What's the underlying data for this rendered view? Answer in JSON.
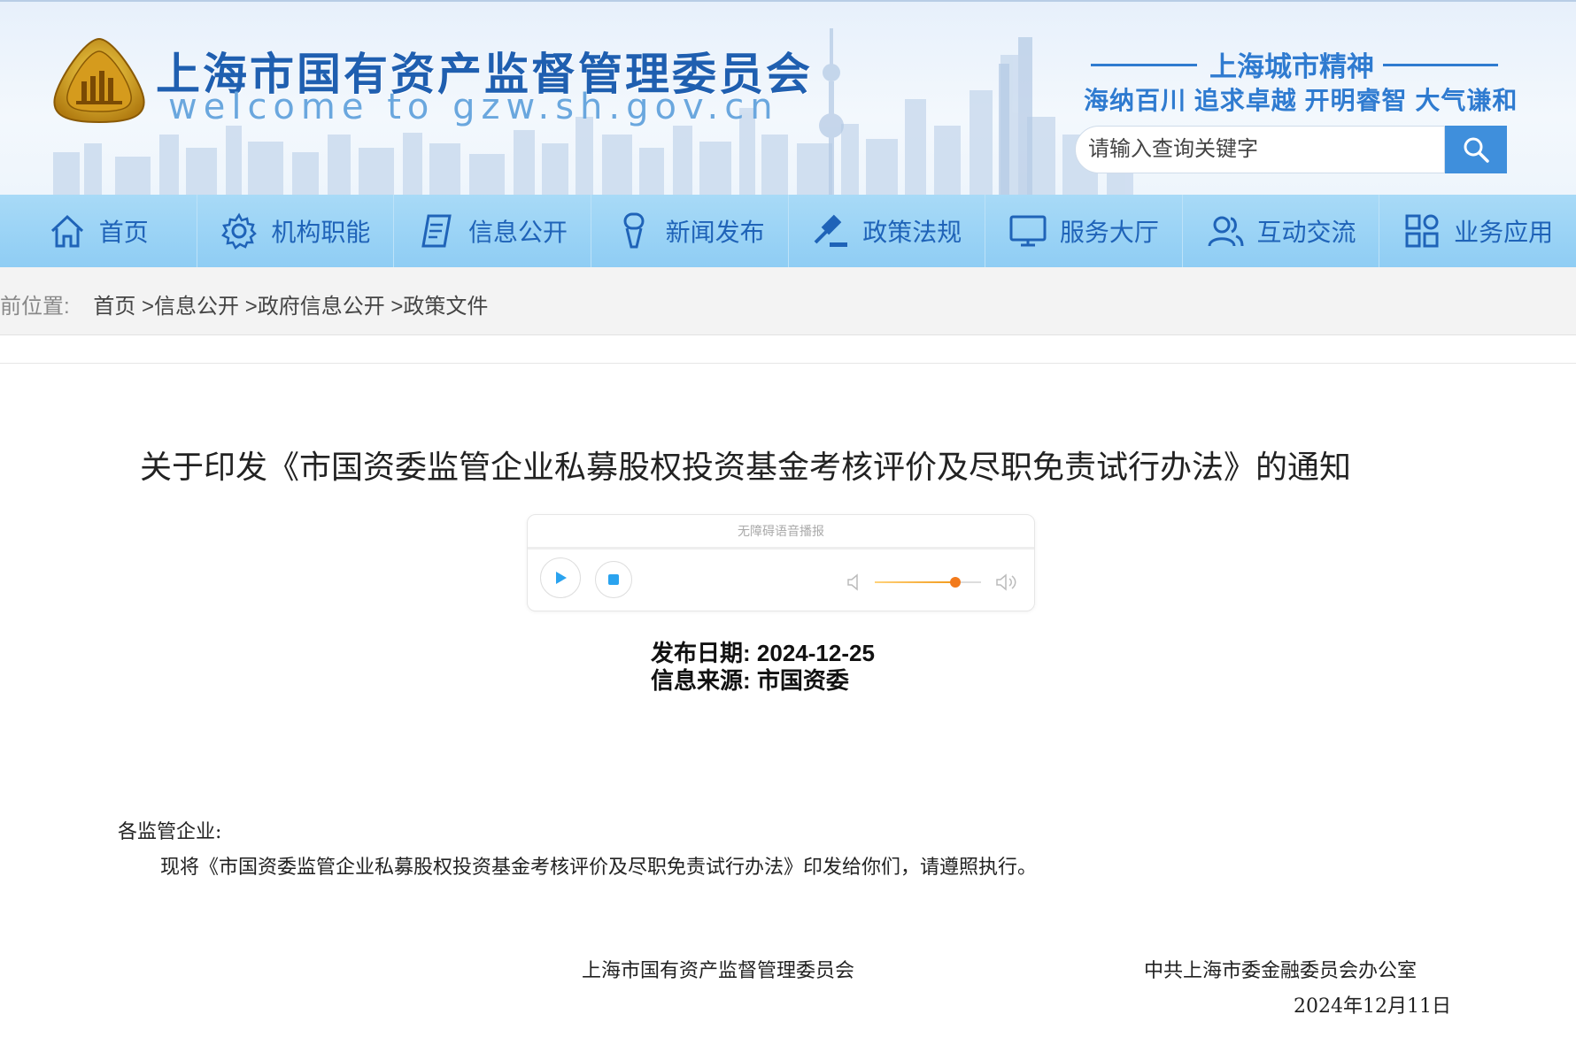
{
  "header": {
    "site_title": "上海市国有资产监督管理委员会",
    "site_subtitle": "welcome to gzw.sh.gov.cn",
    "spirit_title": "上海城市精神",
    "spirit_text": "海纳百川 追求卓越 开明睿智 大气谦和",
    "search_placeholder": "请输入查询关键字"
  },
  "nav": [
    {
      "label": "首页",
      "icon": "home-icon"
    },
    {
      "label": "机构职能",
      "icon": "gear-icon"
    },
    {
      "label": "信息公开",
      "icon": "document-icon"
    },
    {
      "label": "新闻发布",
      "icon": "microphone-icon"
    },
    {
      "label": "政策法规",
      "icon": "gavel-icon"
    },
    {
      "label": "服务大厅",
      "icon": "monitor-icon"
    },
    {
      "label": "互动交流",
      "icon": "users-icon"
    },
    {
      "label": "业务应用",
      "icon": "apps-icon"
    }
  ],
  "breadcrumb": {
    "label": "前位置:",
    "items": [
      "首页",
      ">信息公开",
      ">政府信息公开",
      ">政策文件"
    ]
  },
  "article": {
    "title": "关于印发《市国资委监管企业私募股权投资基金考核评价及尽职免责试行办法》的通知",
    "player_label": "无障碍语音播报",
    "volume_level": 0.76,
    "publish_date_label": "发布日期:",
    "publish_date": "2024-12-25",
    "source_label": "信息来源:",
    "source": "市国资委",
    "salutation": "各监管企业:",
    "body": "现将《市国资委监管企业私募股权投资基金考核评价及尽职免责试行办法》印发给你们，请遵照执行。",
    "signer_1": "上海市国有资产监督管理委员会",
    "signer_2": "中共上海市委金融委员会办公室",
    "sign_date": "2024年12月11日"
  },
  "colors": {
    "title_blue": "#1f5fb0",
    "nav_bg": "#99d1f5",
    "nav_text": "#1f63b8",
    "search_button": "#3f8fdc",
    "volume_accent": "#f27a1b"
  }
}
